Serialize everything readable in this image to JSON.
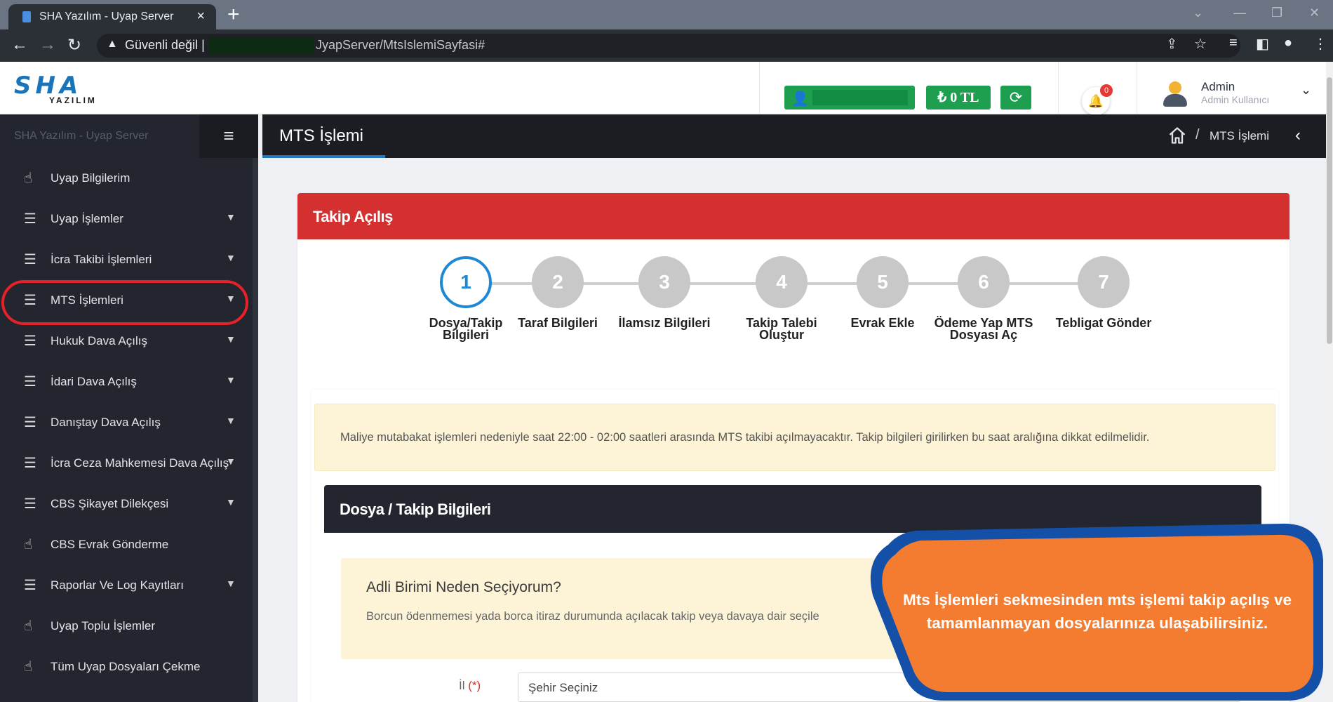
{
  "browser": {
    "tab_title": "SHA Yazılım - Uyap Server",
    "address_security": "Güvenli değil",
    "address_separator": "|",
    "url": "JyapServer/MtsIslemiSayfasi#"
  },
  "header": {
    "logo_text": "SHA",
    "logo_sub": "YAZILIM",
    "balance": "₺ 0 TL",
    "notification_count": "0",
    "user_name": "Admin",
    "user_role": "Admin Kullanıcı"
  },
  "sidebar": {
    "brand": "SHA Yazılım - Uyap Server",
    "items": [
      {
        "label": "Uyap Bilgilerim"
      },
      {
        "label": "Uyap İşlemler"
      },
      {
        "label": "İcra Takibi İşlemleri"
      },
      {
        "label": "MTS İşlemleri"
      },
      {
        "label": "Hukuk Dava Açılış"
      },
      {
        "label": "İdari Dava Açılış"
      },
      {
        "label": "Danıştay Dava Açılış"
      },
      {
        "label": "İcra Ceza Mahkemesi Dava Açılış"
      },
      {
        "label": "CBS Şikayet Dilekçesi"
      },
      {
        "label": "CBS Evrak Gönderme"
      },
      {
        "label": "Raporlar Ve Log Kayıtları"
      },
      {
        "label": "Uyap Toplu İşlemler"
      },
      {
        "label": "Tüm Uyap Dosyaları Çekme"
      }
    ]
  },
  "titlebar": {
    "title": "MTS İşlemi",
    "breadcrumb_sep": "/",
    "breadcrumb_current": "MTS İşlemi"
  },
  "card": {
    "title": "Takip Açılış",
    "steps": [
      {
        "num": "1",
        "label": "Dosya/Takip Bilgileri"
      },
      {
        "num": "2",
        "label": "Taraf Bilgileri"
      },
      {
        "num": "3",
        "label": "İlamsız Bilgileri"
      },
      {
        "num": "4",
        "label": "Takip Talebi Oluştur"
      },
      {
        "num": "5",
        "label": "Evrak Ekle"
      },
      {
        "num": "6",
        "label": "Ödeme Yap MTS Dosyası Aç"
      },
      {
        "num": "7",
        "label": "Tebligat Gönder"
      }
    ],
    "active_step": 1,
    "warning": "Maliye mutabakat işlemleri nedeniyle saat 22:00 - 02:00 saatleri arasında MTS takibi açılmayacaktır. Takip bilgileri girilirken bu saat aralığına dikkat edilmelidir.",
    "section_title": "Dosya / Takip Bilgileri",
    "info_title": "Adli Birimi Neden Seçiyorum?",
    "info_text": "Borcun ödenmemesi yada borca itiraz durumunda açılacak takip veya davaya dair seçile",
    "il_label": "İl",
    "il_required": "(*)",
    "il_placeholder": "Şehir Seçiniz"
  },
  "callout": {
    "text": "Mts İşlemleri sekmesinden mts işlemi takip açılış ve tamamlanmayan dosyalarınıza ulaşabilirsiniz.",
    "fill_color": "#f47c30",
    "border_color": "#1550a8"
  },
  "colors": {
    "accent_red": "#d3302f",
    "accent_green": "#1e9e4f",
    "accent_blue": "#1e88d4",
    "sidebar_bg": "#23262e",
    "highlight_ring": "#e62129"
  }
}
